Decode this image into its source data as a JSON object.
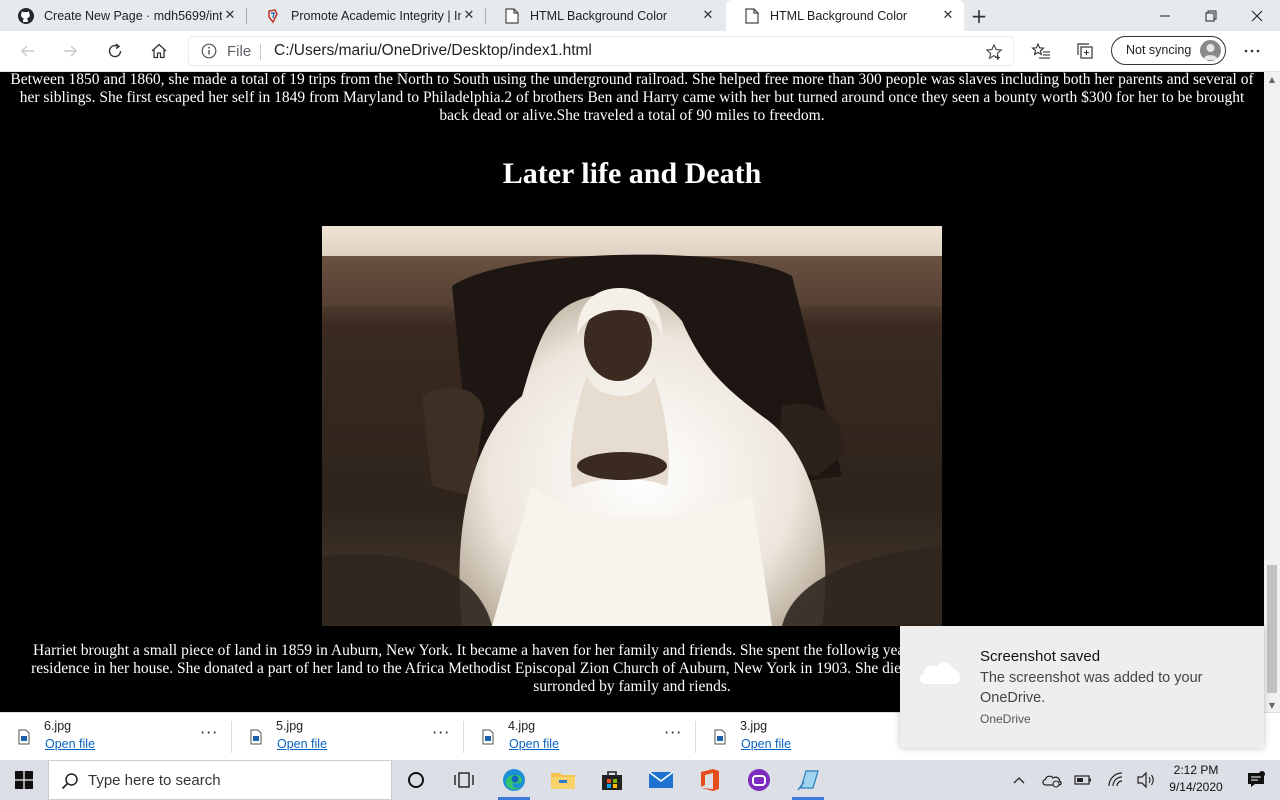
{
  "browser": {
    "tabs": [
      {
        "title": "Create New Page · mdh5699/inte",
        "favicon": "github-icon"
      },
      {
        "title": "Promote Academic Integrity | Im",
        "favicon": "turnitin-icon"
      },
      {
        "title": "HTML Background Color",
        "favicon": "page-icon"
      },
      {
        "title": "HTML Background Color",
        "favicon": "page-icon",
        "active": true
      }
    ],
    "address": {
      "scheme_label": "File",
      "url": "C:/Users/mariu/OneDrive/Desktop/index1.html"
    },
    "sync_label": "Not syncing"
  },
  "page": {
    "top_paragraph": "Between 1850 and 1860, she made a total of 19 trips from the North to South using the underground railroad. She helped free more than 300 people was slaves including both her parents and several of her siblings. She first escaped her self in 1849 from Maryland to Philadelphia.2 of brothers Ben and Harry came with her but turned around once they seen a bounty worth $300 for her to be brought back dead or alive.She traveled a total of 90 miles to freedom.",
    "heading": "Later life and Death",
    "bottom_paragraph": "Harriet brought a small piece of land in 1859 in Auburn, New York. It became a haven for her family and friends. She spent the followig years taking care of her family and friends, who took up residence in her house. She donated a part of her land to the Africa Methodist Episcopal Zion Church of Auburn, New York in 1903. She died from pneumonia on March 10,1913 at the age of 93 surronded by family and riends."
  },
  "downloads": [
    {
      "name": "6.jpg",
      "action": "Open file"
    },
    {
      "name": "5.jpg",
      "action": "Open file"
    },
    {
      "name": "4.jpg",
      "action": "Open file"
    },
    {
      "name": "3.jpg",
      "action": "Open file"
    }
  ],
  "toast": {
    "title": "Screenshot saved",
    "body": "The screenshot was added to your OneDrive.",
    "app": "OneDrive"
  },
  "taskbar": {
    "search_placeholder": "Type here to search",
    "time": "2:12 PM",
    "date": "9/14/2020"
  }
}
